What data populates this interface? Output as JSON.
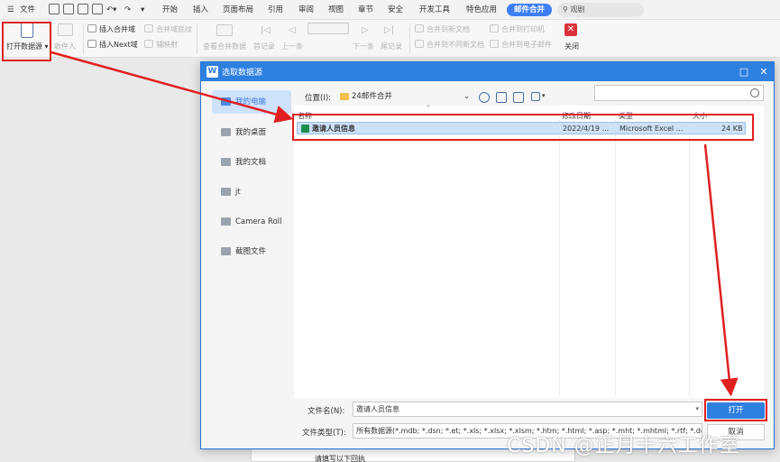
{
  "menubar": {
    "file": "文件",
    "tabs": [
      "开始",
      "插入",
      "页面布局",
      "引用",
      "审阅",
      "视图",
      "章节",
      "安全",
      "开发工具",
      "特色应用"
    ],
    "active_tab": "邮件合并",
    "search": "观剧"
  },
  "ribbon": {
    "open_source": "打开数据源",
    "recipient": "收件人",
    "insert_merge_field": "插入合并域",
    "insert_next_field": "插入Next域",
    "merge_field_shading": "合并域底纹",
    "helper": "辅映射",
    "view_merge_data": "查看合并数据",
    "first_record": "首记录",
    "prev_record": "上一条",
    "next_record": "下一条",
    "last_record": "尾记录",
    "merge_new_doc": "合并到新文档",
    "merge_diff_doc": "合并到不同新文档",
    "merge_printer": "合并到打印机",
    "merge_email": "合并到电子邮件",
    "close": "关闭"
  },
  "dialog": {
    "title": "选取数据源",
    "nav": [
      "我的电脑",
      "我的桌面",
      "我的文档",
      "jt",
      "Camera Roll",
      "截图文件"
    ],
    "location_label": "位置(I):",
    "location_value": "24邮件合并",
    "columns": {
      "name": "名称",
      "date": "修改日期",
      "type": "类型",
      "size": "大小"
    },
    "file": {
      "name": "邀请人员信息",
      "date": "2022/4/19 ...",
      "type": "Microsoft Excel ...",
      "size": "24 KB"
    },
    "filename_label": "文件名(N):",
    "filename_value": "邀请人员信息",
    "filetype_label": "文件类型(T):",
    "filetype_value": "所有数据源(*.mdb; *.dsn; *.et; *.xls; *.xlsx; *.xlsm; *.htm; *.html; *.asp; *.mht; *.mhtml; *.rtf; *.docx; *.doc",
    "open_button": "打开",
    "cancel_button": "取消"
  },
  "document": {
    "text": "请填写以下回执"
  },
  "watermark": "CSDN @正月十六工作室",
  "colors": {
    "accent": "#2d7fe0",
    "annotation": "#e02020"
  }
}
